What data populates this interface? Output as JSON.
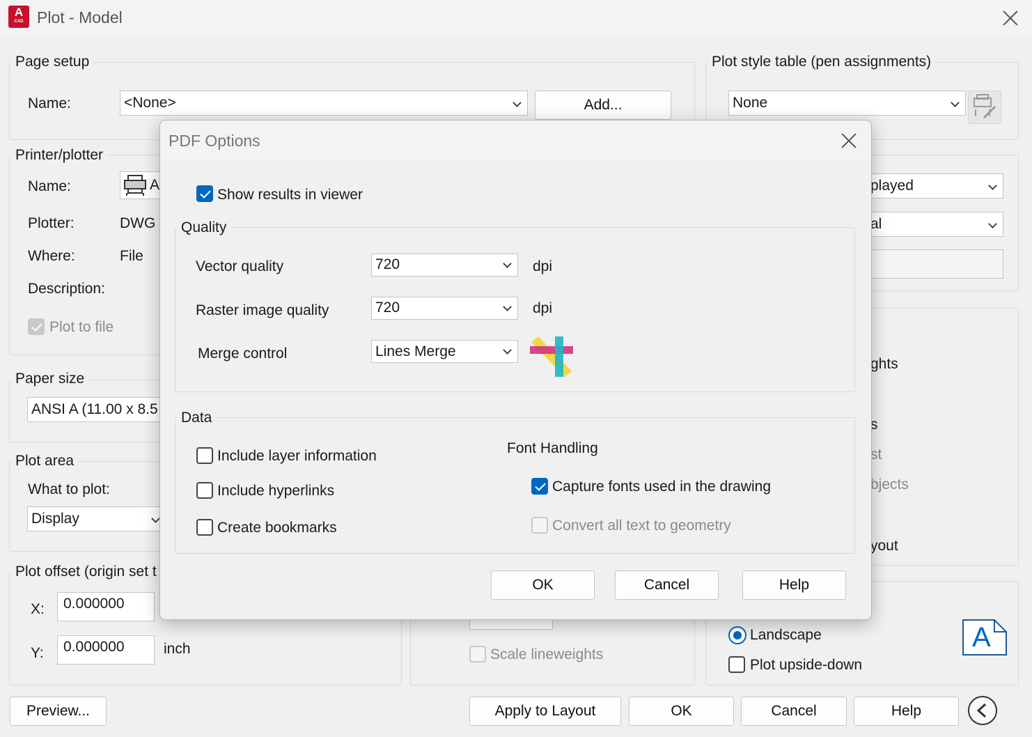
{
  "window": {
    "title": "Plot - Model",
    "app_icon_letter": "A",
    "app_icon_sub": "CAD"
  },
  "page_setup": {
    "group": "Page setup",
    "name_label": "Name:",
    "name_value": "<None>",
    "add_button": "Add..."
  },
  "plot_style": {
    "group": "Plot style table (pen assignments)",
    "value": "None",
    "edit_icon": "plot-style-edit-icon"
  },
  "printer": {
    "group": "Printer/plotter",
    "name_label": "Name:",
    "name_value_partial": "A",
    "plotter_label": "Plotter:",
    "plotter_value_partial": "DWG T",
    "where_label": "Where:",
    "where_value": "File",
    "description_label": "Description:",
    "plot_to_file": "Plot to file",
    "printer_icon": "printer-icon"
  },
  "paper_size": {
    "group": "Paper size",
    "value_partial": "ANSI A (11.00 x 8.5"
  },
  "plot_area": {
    "group": "Plot area",
    "what_label": "What to plot:",
    "what_value": "Display"
  },
  "plot_offset": {
    "group_partial": "Plot offset (origin set t",
    "x_label": "X:",
    "x_value": "0.000000",
    "y_label": "Y:",
    "y_value": "0.000000",
    "unit": "inch"
  },
  "right_partials": {
    "shade_combo": "played",
    "quality_combo": "al",
    "lineweights": "ghts",
    "styles": "s",
    "last": "st",
    "objects": "bjects",
    "layout": "yout",
    "scale_lineweights": "Scale lineweights"
  },
  "orientation": {
    "landscape": "Landscape",
    "upside_down": "Plot upside-down",
    "orientation_icon_letter": "A"
  },
  "footer": {
    "preview": "Preview...",
    "apply": "Apply to Layout",
    "ok": "OK",
    "cancel": "Cancel",
    "help": "Help",
    "collapse_icon": "chevron-left-icon"
  },
  "pdf_options": {
    "title": "PDF Options",
    "show_results": "Show results in viewer",
    "quality": {
      "group": "Quality",
      "vector_label": "Vector quality",
      "vector_value": "720",
      "raster_label": "Raster image quality",
      "raster_value": "720",
      "unit": "dpi",
      "merge_label": "Merge control",
      "merge_value": "Lines Merge",
      "merge_icon": "lines-merge-icon"
    },
    "data": {
      "group": "Data",
      "layer_info": "Include layer information",
      "hyperlinks": "Include hyperlinks",
      "bookmarks": "Create bookmarks",
      "font_handling": "Font Handling",
      "capture_fonts": "Capture fonts used in the drawing",
      "convert_text": "Convert all text to geometry"
    },
    "buttons": {
      "ok": "OK",
      "cancel": "Cancel",
      "help": "Help"
    }
  }
}
